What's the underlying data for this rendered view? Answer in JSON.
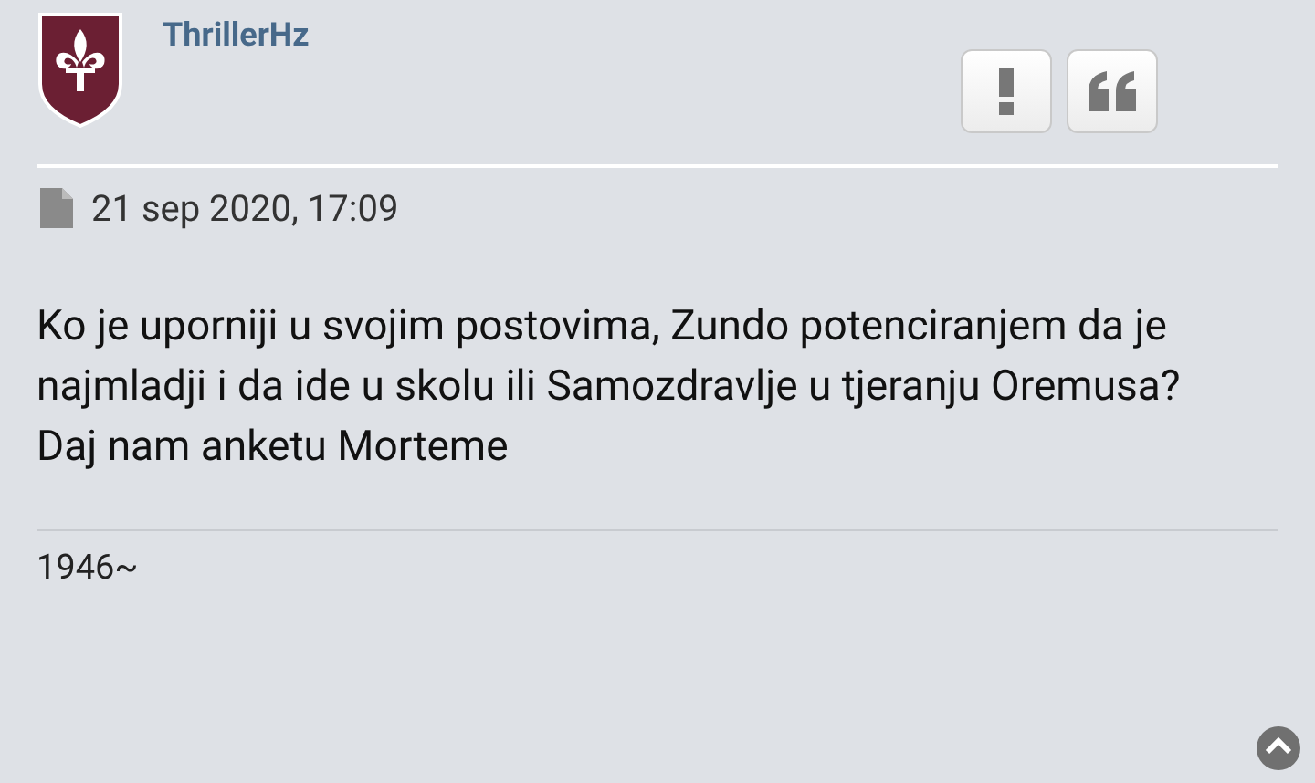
{
  "post": {
    "author": "ThrillerHz",
    "date": "21 sep 2020, 17:09",
    "content": [
      "Ko je uporniji u svojim postovima, Zundo potenciranjem da je najmladji i da ide u skolu ili Samozdravlje u tjeranju Oremusa?",
      "Daj nam anketu Morteme"
    ],
    "signature": "1946~"
  }
}
